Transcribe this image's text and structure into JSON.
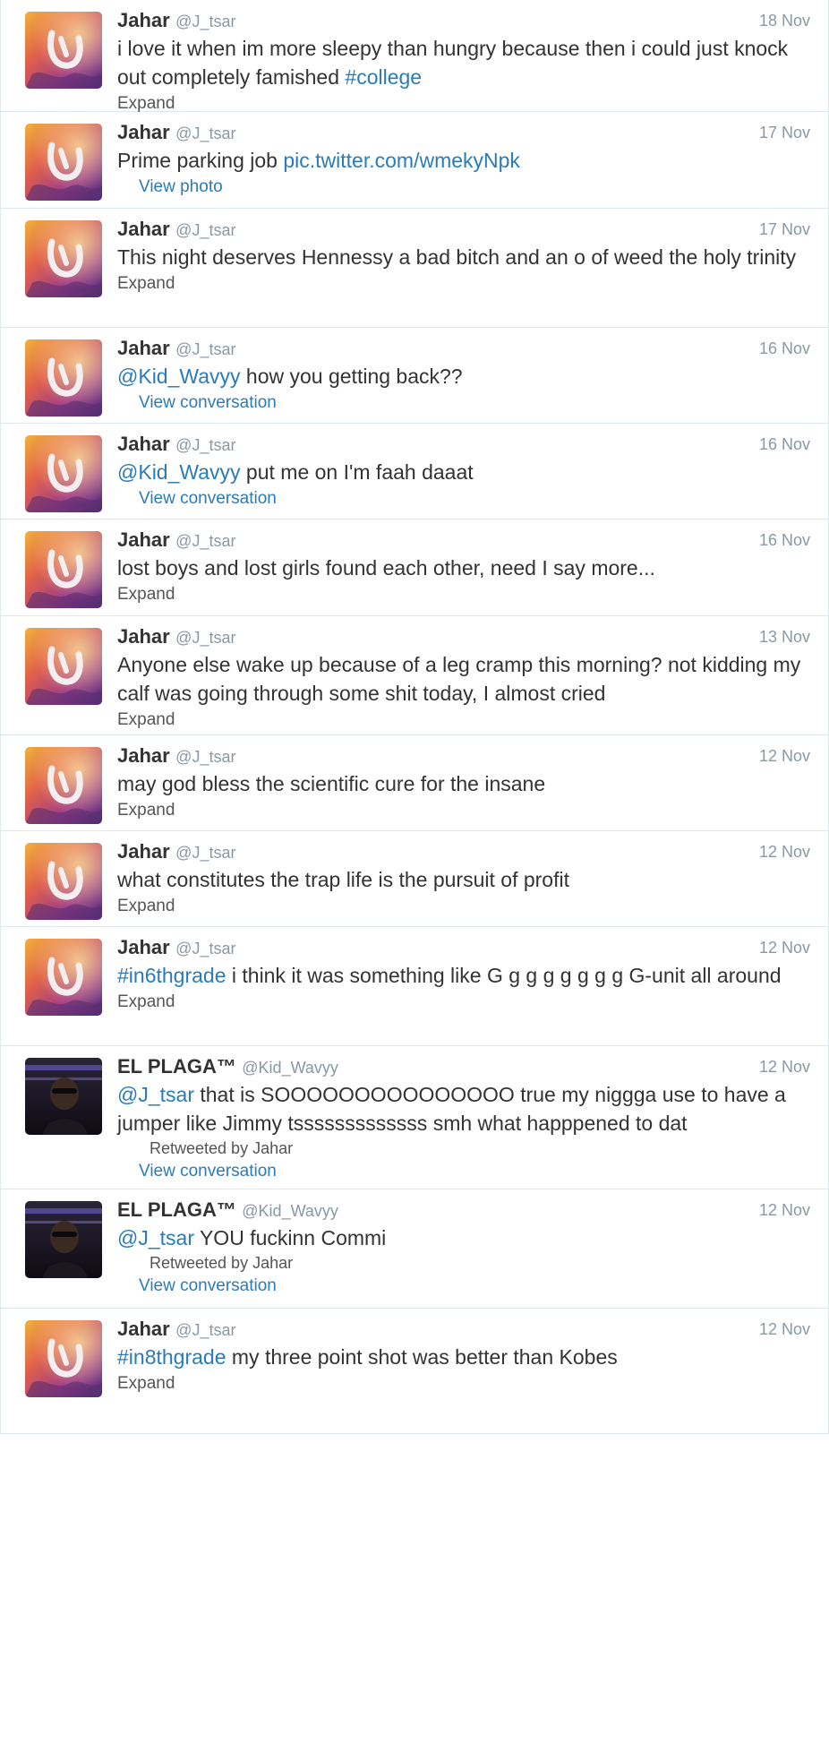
{
  "tweets": [
    {
      "name": "Jahar",
      "handle": "@J_tsar",
      "time": "18 Nov",
      "avatar": "jahar-avatar",
      "parts": [
        {
          "t": "i love it when im more sleepy than hungry because then i could just knock out completely famished "
        },
        {
          "t": "#college",
          "link": true
        }
      ],
      "action": "Expand"
    },
    {
      "name": "Jahar",
      "handle": "@J_tsar",
      "time": "17 Nov",
      "avatar": "jahar-avatar",
      "parts": [
        {
          "t": "Prime parking job "
        },
        {
          "t": "pic.twitter.com/wmekyNpk",
          "link": true
        }
      ],
      "action": "View photo",
      "action_blue": true
    },
    {
      "name": "Jahar",
      "handle": "@J_tsar",
      "time": "17 Nov",
      "avatar": "jahar-avatar",
      "parts": [
        {
          "t": "This night deserves Hennessy a bad bitch and an o of weed the holy trinity"
        }
      ],
      "action": "Expand"
    },
    {
      "name": "Jahar",
      "handle": "@J_tsar",
      "time": "16 Nov",
      "avatar": "jahar-avatar",
      "parts": [
        {
          "t": "@Kid_Wavyy",
          "link": true
        },
        {
          "t": " how you getting back??"
        }
      ],
      "action": "View conversation",
      "action_blue": true
    },
    {
      "name": "Jahar",
      "handle": "@J_tsar",
      "time": "16 Nov",
      "avatar": "jahar-avatar",
      "parts": [
        {
          "t": "@Kid_Wavyy",
          "link": true
        },
        {
          "t": " put me on I'm faah daaat"
        }
      ],
      "action": "View conversation",
      "action_blue": true
    },
    {
      "name": "Jahar",
      "handle": "@J_tsar",
      "time": "16 Nov",
      "avatar": "jahar-avatar",
      "parts": [
        {
          "t": "lost boys and lost girls found each other, need I say more..."
        }
      ],
      "action": "Expand"
    },
    {
      "name": "Jahar",
      "handle": "@J_tsar",
      "time": "13 Nov",
      "avatar": "jahar-avatar",
      "parts": [
        {
          "t": "Anyone else wake up because of a leg cramp this morning? not kidding my calf was going through some shit today, I almost cried"
        }
      ],
      "action": "Expand"
    },
    {
      "name": "Jahar",
      "handle": "@J_tsar",
      "time": "12 Nov",
      "avatar": "jahar-avatar",
      "parts": [
        {
          "t": "may god bless the scientific cure for the insane"
        }
      ],
      "action": "Expand"
    },
    {
      "name": "Jahar",
      "handle": "@J_tsar",
      "time": "12 Nov",
      "avatar": "jahar-avatar",
      "parts": [
        {
          "t": "what constitutes the trap life is the pursuit of profit"
        }
      ],
      "action": "Expand"
    },
    {
      "name": "Jahar",
      "handle": "@J_tsar",
      "time": "12 Nov",
      "avatar": "jahar-avatar",
      "parts": [
        {
          "t": "#in6thgrade",
          "link": true
        },
        {
          "t": " i think it was something like G g g g g g g g G-unit all around"
        }
      ],
      "action": "Expand"
    },
    {
      "name": "EL PLAGA™",
      "handle": "@Kid_Wavyy",
      "time": "12 Nov",
      "avatar": "elplaga-avatar",
      "parts": [
        {
          "t": "@J_tsar",
          "link": true
        },
        {
          "t": " that is SOOOOOOOOOOOOOOO true my niggga use to have a jumper like Jimmy tsssssssssssss smh what happpened to dat"
        }
      ],
      "retweeted": "Retweeted by Jahar",
      "action": "View conversation",
      "action_blue": true
    },
    {
      "name": "EL PLAGA™",
      "handle": "@Kid_Wavyy",
      "time": "12 Nov",
      "avatar": "elplaga-avatar",
      "parts": [
        {
          "t": "@J_tsar",
          "link": true
        },
        {
          "t": " YOU fuckinn Commi"
        }
      ],
      "retweeted": "Retweeted by Jahar",
      "action": "View conversation",
      "action_blue": true
    },
    {
      "name": "Jahar",
      "handle": "@J_tsar",
      "time": "12 Nov",
      "avatar": "jahar-avatar",
      "parts": [
        {
          "t": "#in8thgrade",
          "link": true
        },
        {
          "t": " my three point shot was better than Kobes"
        }
      ],
      "action": "Expand"
    }
  ]
}
